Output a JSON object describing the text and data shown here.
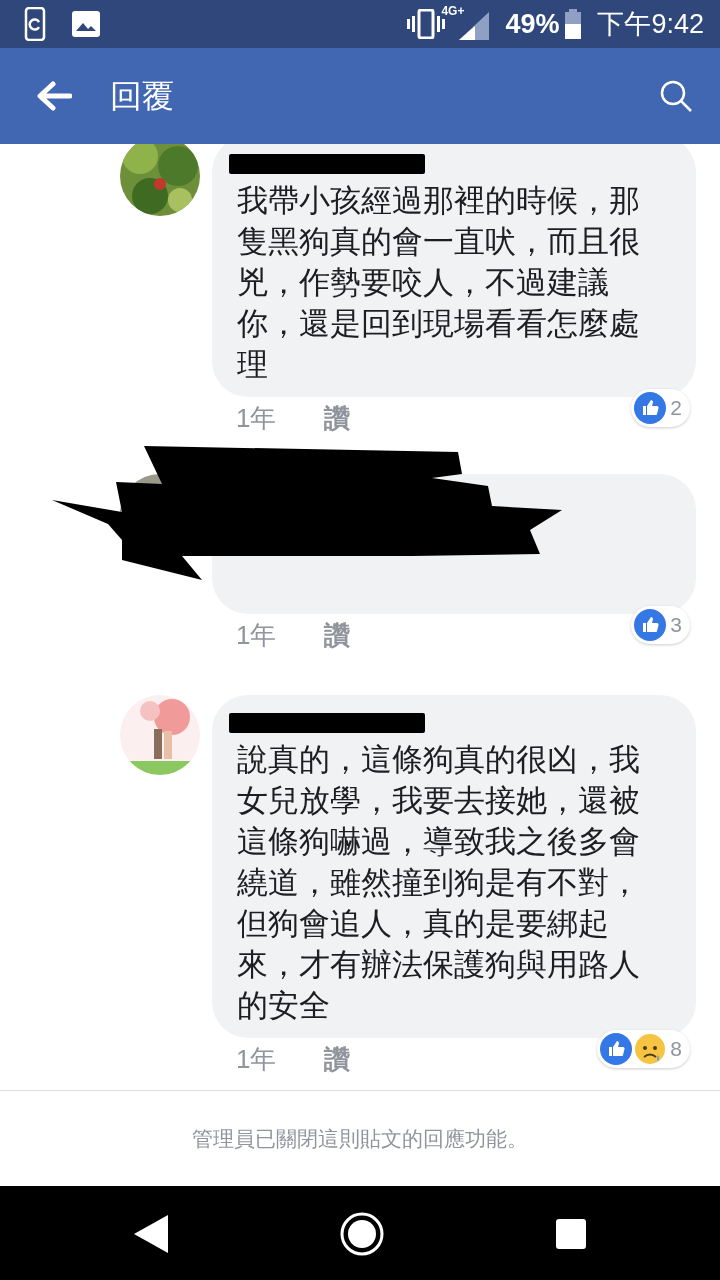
{
  "status_bar": {
    "network": "4G+",
    "battery": "49%",
    "time": "下午9:42"
  },
  "app_bar": {
    "title": "回覆"
  },
  "comments": [
    {
      "redacted": false,
      "text": "我帶小孩經過那裡的時候，那隻黑狗真的會一直吠，而且很兇，作勢要咬人，不過建議你，還是回到現場看看怎麼處理",
      "time": "1年",
      "like_label": "讚",
      "reactions": [
        {
          "kind": "like"
        }
      ],
      "count": "2"
    },
    {
      "redacted": true,
      "time": "1年",
      "like_label": "讚",
      "reactions": [
        {
          "kind": "like"
        }
      ],
      "count": "3"
    },
    {
      "redacted": false,
      "text": "說真的，這條狗真的很凶，我女兒放學，我要去接她，還被這條狗嚇過，導致我之後多會繞道，雖然撞到狗是有不對，但狗會追人，真的是要綁起來，才有辦法保護狗與用路人的安全",
      "time": "1年",
      "like_label": "讚",
      "reactions": [
        {
          "kind": "like"
        },
        {
          "kind": "sad"
        }
      ],
      "count": "8"
    }
  ],
  "footer": {
    "notice": "管理員已關閉這則貼文的回應功能。"
  }
}
